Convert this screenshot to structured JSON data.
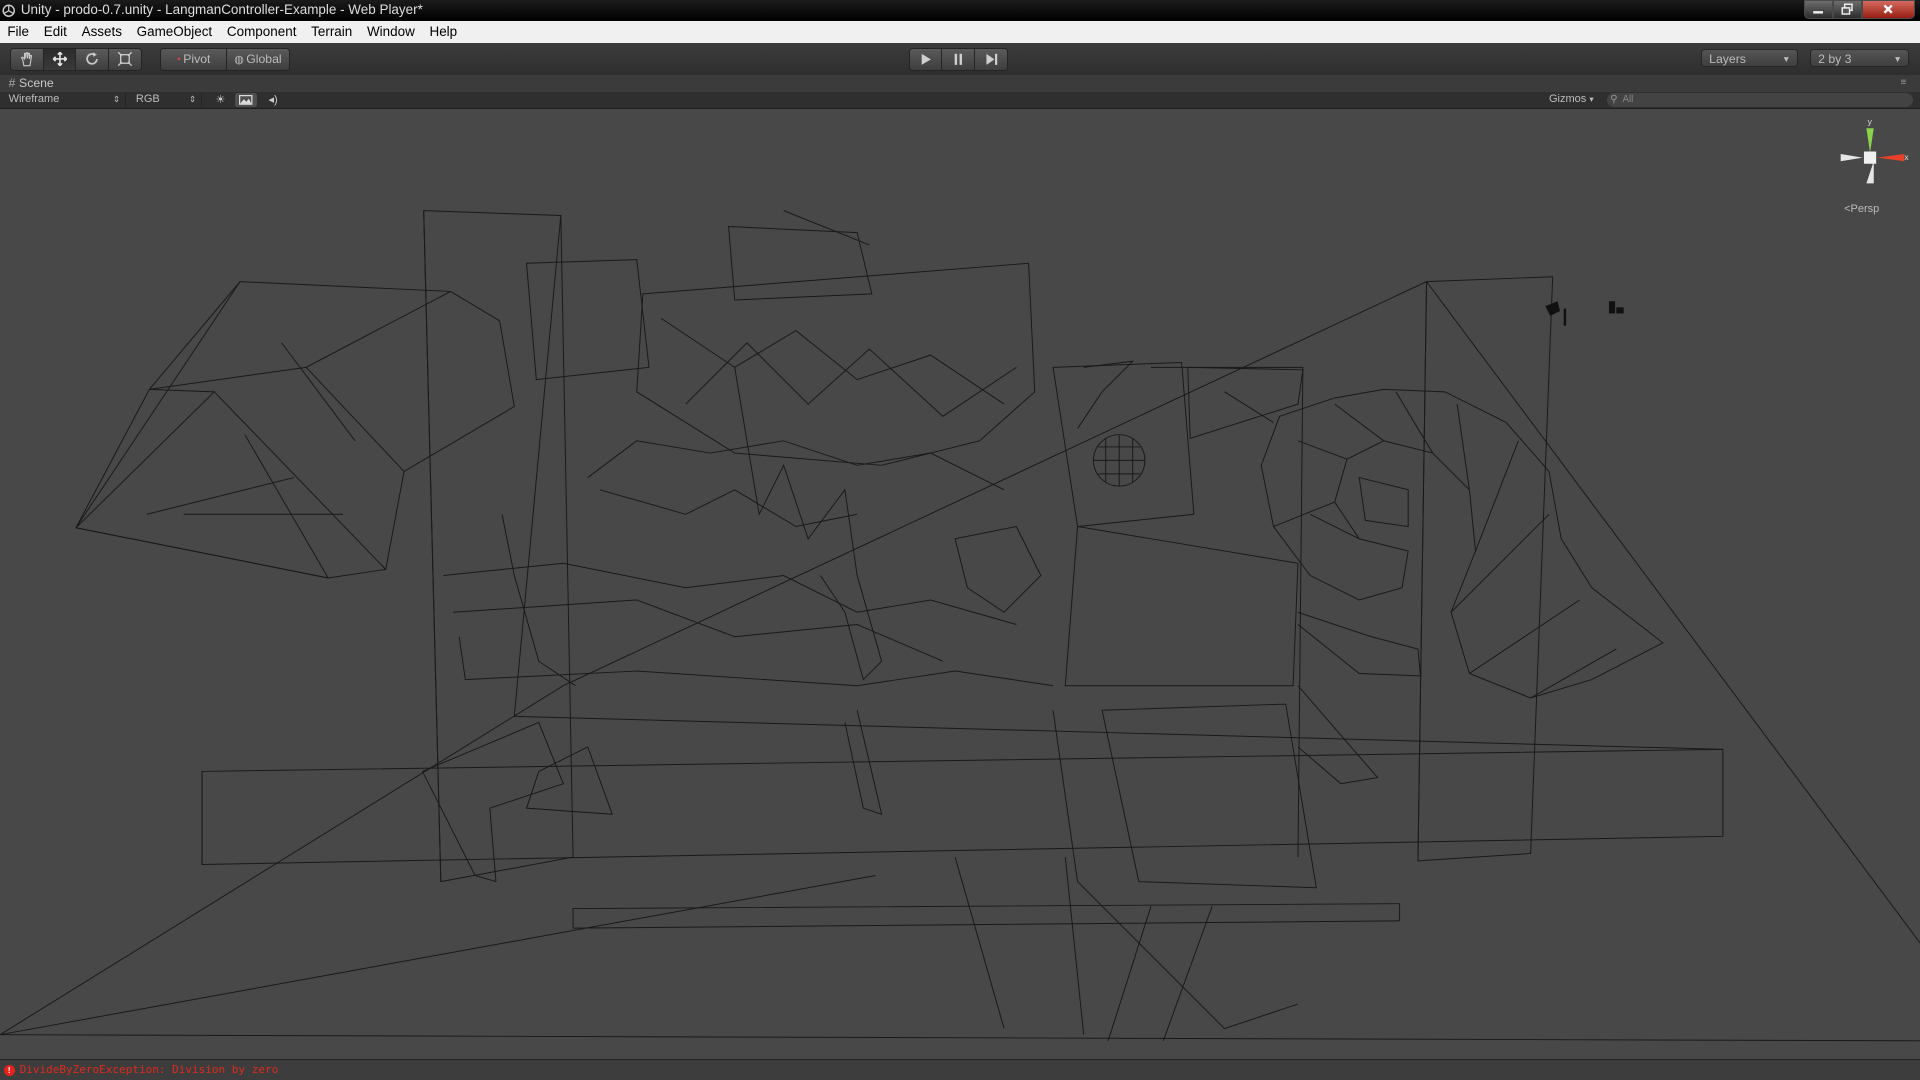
{
  "window": {
    "title": "Unity - prodo-0.7.unity - LangmanController-Example - Web Player*",
    "icon": "unity-icon",
    "buttons": [
      "minimize-icon",
      "maximize-icon",
      "close-icon"
    ]
  },
  "menu": [
    "File",
    "Edit",
    "Assets",
    "GameObject",
    "Component",
    "Terrain",
    "Window",
    "Help"
  ],
  "toolbar": {
    "transform_tools": [
      "hand-icon",
      "move-icon",
      "rotate-icon",
      "scale-icon"
    ],
    "active_tool": "move-icon",
    "pivot_label": "Pivot",
    "global_label": "Global",
    "playback": [
      "play-icon",
      "pause-icon",
      "step-icon"
    ],
    "layers_label": "Layers",
    "layout_label": "2 by 3"
  },
  "scene": {
    "tab_label": "Scene",
    "render_mode": "Wireframe",
    "color_mode": "RGB",
    "toggles": [
      "lighting-icon",
      "image-effects-icon",
      "audio-icon"
    ],
    "gizmos_label": "Gizmos",
    "search_placeholder": "All",
    "view_label": "Persp",
    "axes": {
      "y": "y",
      "x": "x"
    }
  },
  "status": {
    "message": "DivideByZeroException: Division by zero",
    "error_color": "#e02a1c"
  }
}
